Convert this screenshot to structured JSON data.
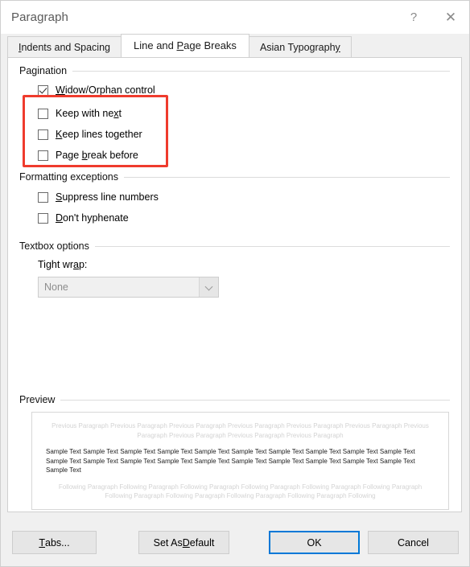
{
  "window": {
    "title": "Paragraph",
    "help_icon": "question-mark-icon",
    "close_icon": "close-x-icon",
    "help_glyph": "?",
    "close_glyph": "✕"
  },
  "tabs": [
    {
      "label_pre": "",
      "label_accel": "I",
      "label_post": "ndents and Spacing",
      "active": false
    },
    {
      "label_pre": "Line and ",
      "label_accel": "P",
      "label_post": "age Breaks",
      "active": true
    },
    {
      "label_pre": "Asian Typograph",
      "label_accel": "y",
      "label_post": "",
      "active": false
    }
  ],
  "groups": {
    "pagination": {
      "label": "Pagination",
      "options": [
        {
          "pre": "",
          "accel": "W",
          "post": "idow/Orphan control",
          "checked": true
        },
        {
          "pre": "Keep with ne",
          "accel": "x",
          "post": "t",
          "checked": false
        },
        {
          "pre": "",
          "accel": "K",
          "post": "eep lines together",
          "checked": false
        },
        {
          "pre": "Page ",
          "accel": "b",
          "post": "reak before",
          "checked": false
        }
      ]
    },
    "formatting_exceptions": {
      "label": "Formatting exceptions",
      "options": [
        {
          "pre": "",
          "accel": "S",
          "post": "uppress line numbers",
          "checked": false
        },
        {
          "pre": "",
          "accel": "D",
          "post": "on't hyphenate",
          "checked": false
        }
      ]
    },
    "textbox_options": {
      "label": "Textbox options",
      "tight_wrap_label_pre": "Tight wr",
      "tight_wrap_label_accel": "a",
      "tight_wrap_label_post": "p:",
      "tight_wrap_value": "None",
      "tight_wrap_disabled": true,
      "chevron_icon": "chevron-down-icon"
    },
    "preview": {
      "label": "Preview",
      "previous_paragraph": "Previous Paragraph Previous Paragraph Previous Paragraph Previous Paragraph Previous Paragraph Previous Paragraph Previous Paragraph Previous Paragraph Previous Paragraph Previous Paragraph",
      "sample_text": "Sample Text Sample Text Sample Text Sample Text Sample Text Sample Text Sample Text Sample Text Sample Text Sample Text Sample Text Sample Text Sample Text Sample Text Sample Text Sample Text Sample Text Sample Text Sample Text Sample Text Sample Text",
      "following_paragraph": "Following Paragraph Following Paragraph Following Paragraph Following Paragraph Following Paragraph Following Paragraph Following Paragraph Following Paragraph Following Paragraph Following Paragraph Following"
    }
  },
  "annotation": {
    "color": "#ef3b2d",
    "shape": "rectangle"
  },
  "footer": {
    "tabs_button": {
      "pre": "",
      "accel": "T",
      "post": "abs..."
    },
    "set_as_default_button": {
      "pre": "Set As ",
      "accel": "D",
      "post": "efault"
    },
    "ok_button": {
      "pre": "OK",
      "accel": "",
      "post": ""
    },
    "cancel_button": {
      "pre": "Cancel",
      "accel": "",
      "post": ""
    }
  },
  "colors": {
    "accent": "#0078d7",
    "annotation": "#ef3b2d",
    "dialog_bg": "#f0f0f0",
    "panel_bg": "#ffffff"
  }
}
